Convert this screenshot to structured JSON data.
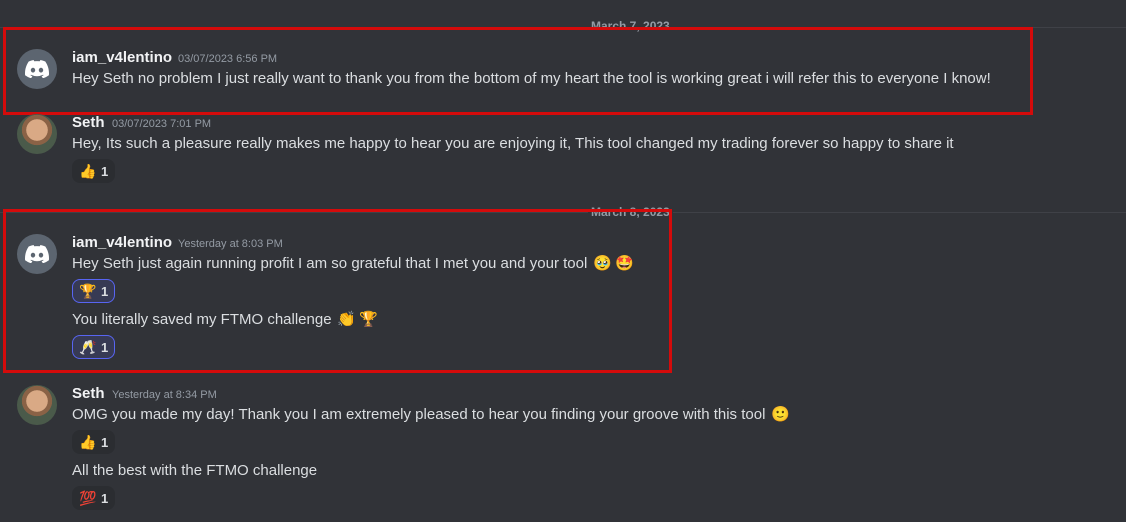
{
  "dividers": {
    "first": "March 7, 2023",
    "second": "March 8, 2023"
  },
  "messages": [
    {
      "author": "iam_v4lentino",
      "time": "03/07/2023 6:56 PM",
      "text": "Hey Seth no problem I just really want to thank you from the bottom of my heart the tool is working great i will refer this to everyone I know!"
    },
    {
      "author": "Seth",
      "time": "03/07/2023 7:01 PM",
      "text": "Hey, Its such a pleasure really makes me happy to hear you are enjoying it, This tool changed my trading forever so happy to share it",
      "reaction": {
        "emoji": "👍",
        "count": "1"
      }
    },
    {
      "author": "iam_v4lentino",
      "time": "Yesterday at 8:03 PM",
      "text": "Hey Seth just again running profit I am so grateful that I met you and your tool",
      "reaction": {
        "emoji": "🏆",
        "count": "1"
      },
      "text2": "You literally saved my FTMO challenge",
      "reaction2": {
        "emoji": "🥂",
        "count": "1"
      }
    },
    {
      "author": "Seth",
      "time": "Yesterday at 8:34 PM",
      "text": "OMG you made my day! Thank you I am extremely pleased to hear you finding your groove with this tool",
      "reaction": {
        "emoji": "👍",
        "count": "1"
      },
      "text2": "All the best with the FTMO challenge",
      "reaction2": {
        "emoji": "💯",
        "count": "1"
      }
    }
  ],
  "emojis": {
    "m3_inline": [
      "🥹",
      "🤩"
    ],
    "m3_second_inline": [
      "👏",
      "🏆"
    ],
    "m4_inline": [
      "🙂"
    ]
  },
  "colors": {
    "background": "#313338",
    "highlight_box": "#d40b0b",
    "reaction_me_border": "#5865f2"
  }
}
